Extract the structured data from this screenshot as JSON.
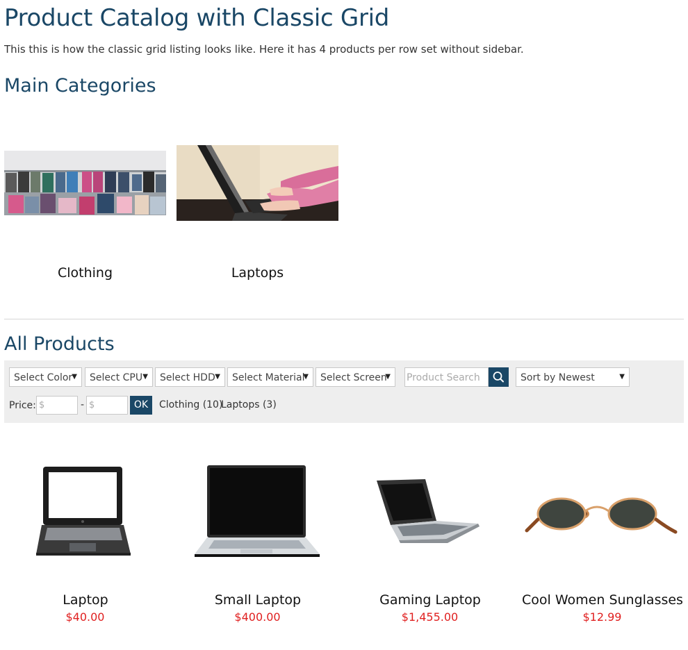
{
  "page": {
    "title": "Product Catalog with Classic Grid",
    "intro": "This this is how the classic grid listing looks like. Here it has 4 products per row set without sidebar."
  },
  "main_categories": {
    "title": "Main Categories",
    "items": [
      {
        "name": "Clothing",
        "image": "clothing-store-photo"
      },
      {
        "name": "Laptops",
        "image": "typing-on-laptop-photo"
      }
    ]
  },
  "all_products": {
    "title": "All Products",
    "filters": {
      "selects": [
        "Select Color",
        "Select CPU",
        "Select HDD",
        "Select Material",
        "Select Screen"
      ],
      "search_placeholder": "Product Search",
      "search_icon": "search-icon",
      "sort": "Sort by Newest",
      "price_label": "Price:",
      "price_min_placeholder": "$",
      "price_max_placeholder": "$",
      "price_separator": "-",
      "ok_label": "OK",
      "category_counts": [
        "Clothing (10)",
        "Laptops (3)"
      ]
    },
    "products": [
      {
        "name": "Laptop",
        "price": "$40.00",
        "image": "tablet-laptop-photo"
      },
      {
        "name": "Small Laptop",
        "price": "$400.00",
        "image": "silver-laptop-photo"
      },
      {
        "name": "Gaming Laptop",
        "price": "$1,455.00",
        "image": "gaming-laptop-photo"
      },
      {
        "name": "Cool Women Sunglasses",
        "price": "$12.99",
        "image": "sunglasses-photo"
      }
    ]
  },
  "colors": {
    "heading": "#1a4766",
    "accent": "#1a4766",
    "price": "#e02020",
    "filter_bg": "#eeeeee"
  }
}
